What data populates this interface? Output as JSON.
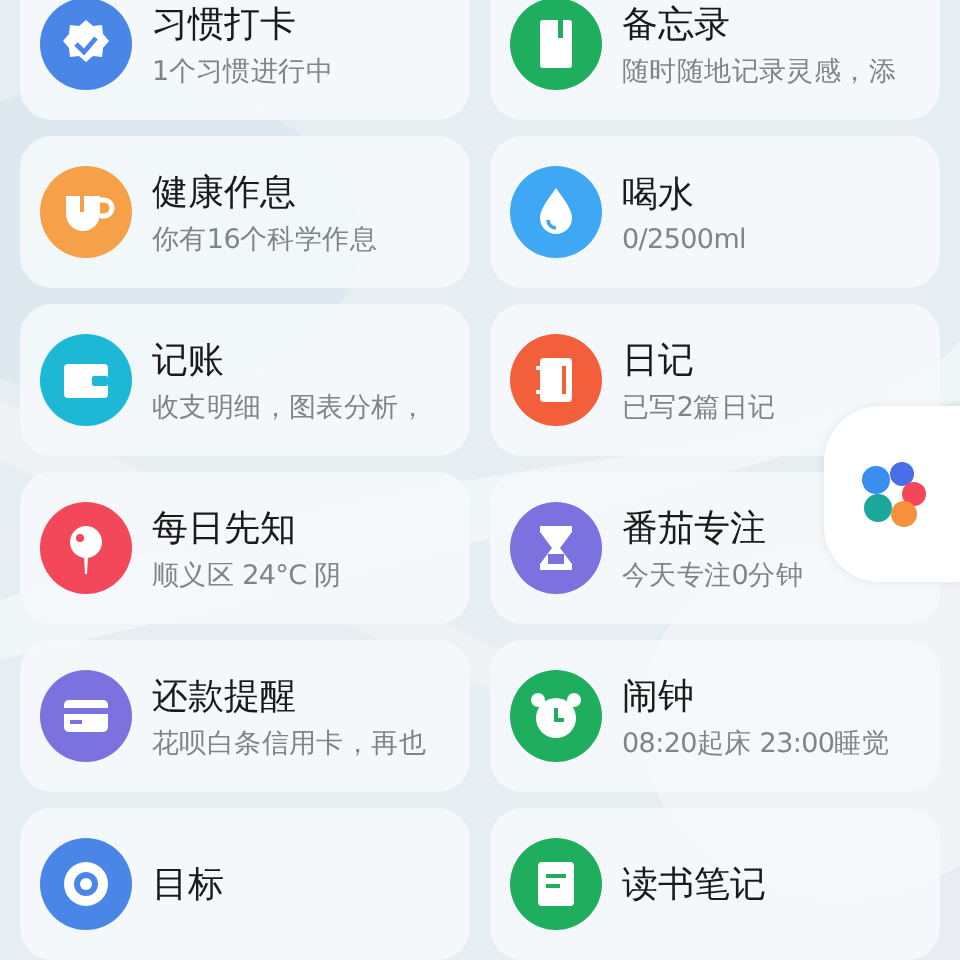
{
  "tools": [
    {
      "title": "习惯打卡",
      "subtitle": "1个习惯进行中",
      "color": "#4a86e8"
    },
    {
      "title": "备忘录",
      "subtitle": "随时随地记录灵感，添",
      "color": "#1fae5e"
    },
    {
      "title": "健康作息",
      "subtitle": "你有16个科学作息",
      "color": "#f7a04a"
    },
    {
      "title": "喝水",
      "subtitle": "0/2500ml",
      "color": "#3ea8f5"
    },
    {
      "title": "记账",
      "subtitle": "收支明细，图表分析，",
      "color": "#1db8d6"
    },
    {
      "title": "日记",
      "subtitle": "已写2篇日记",
      "color": "#f35f3a"
    },
    {
      "title": "每日先知",
      "subtitle": "顺义区 24°C 阴",
      "color": "#f2485a"
    },
    {
      "title": "番茄专注",
      "subtitle": "今天专注0分钟",
      "color": "#7b72e0"
    },
    {
      "title": "还款提醒",
      "subtitle": "花呗白条信用卡，再也",
      "color": "#7b72e0"
    },
    {
      "title": "闹钟",
      "subtitle": "08:20起床 23:00睡觉",
      "color": "#1fae5e"
    },
    {
      "title": "目标",
      "color": "#4a86e8"
    },
    {
      "title": "读书笔记",
      "color": "#1fae5e"
    }
  ]
}
